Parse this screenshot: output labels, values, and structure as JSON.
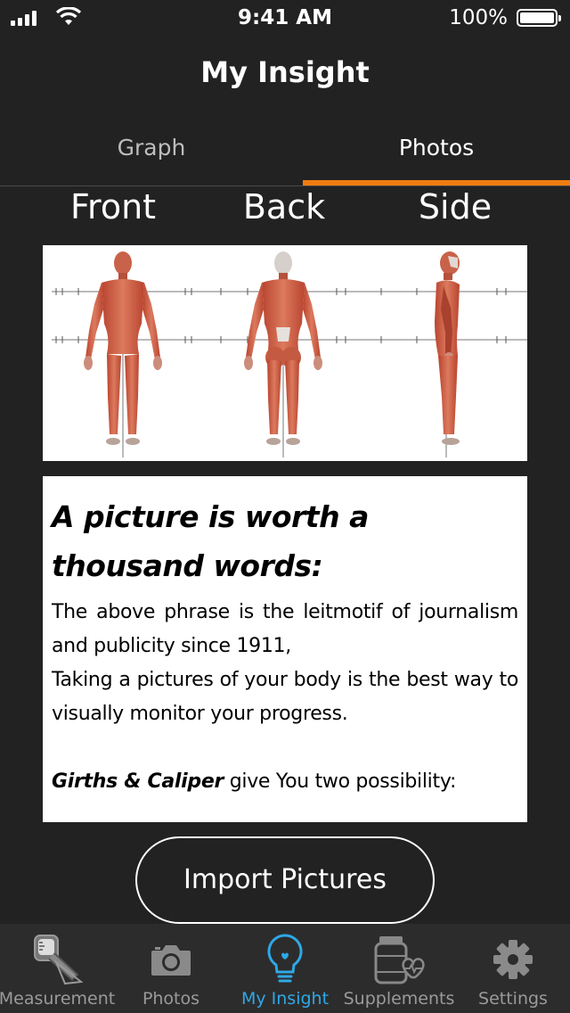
{
  "status_bar": {
    "time": "9:41 AM",
    "battery": "100%"
  },
  "nav": {
    "title": "My Insight"
  },
  "tabs": {
    "graph": "Graph",
    "photos": "Photos",
    "accent": "#f07c10"
  },
  "view_labels": {
    "front": "Front",
    "back": "Back",
    "side": "Side"
  },
  "card": {
    "heading": "A picture is worth a thousand words:",
    "body_1": "The above phrase is the leitmotif of journalism and publicity since 1911,",
    "body_2": "Taking a pictures of your body is the best way to visually monitor your progress.",
    "footer_bold": "Girths & Caliper",
    "footer_rest": " give You two possibility:"
  },
  "import_button": "Import Pictures",
  "tab_bar": {
    "active_color": "#2fa8e6",
    "items": [
      {
        "label": "Measurement",
        "icon": "tape-measure-icon"
      },
      {
        "label": "Photos",
        "icon": "camera-icon"
      },
      {
        "label": "My Insight",
        "icon": "lightbulb-icon"
      },
      {
        "label": "Supplements",
        "icon": "supplements-icon"
      },
      {
        "label": "Settings",
        "icon": "gear-icon"
      }
    ]
  }
}
